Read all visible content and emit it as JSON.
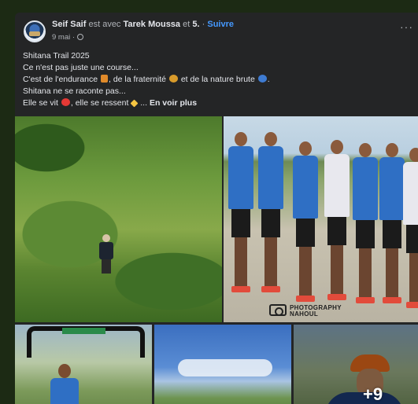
{
  "post": {
    "author": "Seif Saif",
    "with_text": "est avec",
    "tagged": "Tarek Moussa",
    "and_text": "et",
    "others": "5.",
    "separator": "·",
    "follow": "Suivre",
    "date": "9 mai",
    "privacy_icon": "globe-icon",
    "more_icon": "···",
    "lines": [
      "Shitana Trail 2025",
      "Ce n'est pas juste une course...",
      "C'est de l'endurance",
      ", de la fraternité",
      "et de la nature brute",
      ".",
      "Shitana ne se raconte pas...",
      "Elle se vit",
      ", elle se ressent",
      "...",
      "En voir plus"
    ]
  },
  "photos": {
    "watermark_line1": "PHOTOGRAPHY",
    "watermark_line2": "NAHOUL",
    "more_count": "+9"
  }
}
